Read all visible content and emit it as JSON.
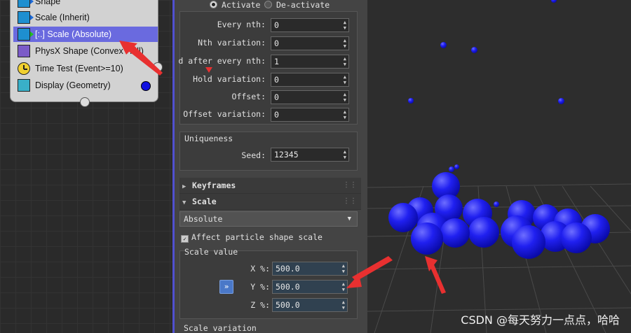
{
  "particle_view": {
    "operators": [
      {
        "label": "Shape",
        "icon": "shape-icon"
      },
      {
        "label": "Scale (Inherit)",
        "icon": "scale-icon"
      },
      {
        "label": "[:.] Scale (Absolute)",
        "icon": "scale-icon",
        "selected": true
      },
      {
        "label": "PhysX Shape (Convex Hull)",
        "icon": "physx-shape-icon"
      },
      {
        "label": "Time Test (Event>=10)",
        "icon": "clock-icon"
      },
      {
        "label": "Display (Geometry)",
        "icon": "display-icon"
      }
    ]
  },
  "params": {
    "activate_label": "Activate",
    "deactivate_label": "De-activate",
    "rows": [
      {
        "label": "Every nth:",
        "value": "0"
      },
      {
        "label": "Nth variation:",
        "value": "0"
      },
      {
        "label": "d after every nth:",
        "value": "1"
      },
      {
        "label": "Hold variation:",
        "value": "0"
      },
      {
        "label": "Offset:",
        "value": "0"
      },
      {
        "label": "Offset variation:",
        "value": "0"
      }
    ],
    "uniqueness_title": "Uniqueness",
    "seed_label": "Seed:",
    "seed_value": "12345",
    "keyframes_title": "Keyframes",
    "scale_title": "Scale",
    "scale_type": "Absolute",
    "affect_label": "Affect particle shape scale",
    "scale_value_title": "Scale value",
    "x_label": "X %:",
    "x_value": "500.0",
    "y_label": "Y %:",
    "y_value": "500.0",
    "z_label": "Z %:",
    "z_value": "500.0",
    "link_label": "»",
    "scale_variation_title": "Scale variation"
  },
  "watermark": "CSDN @每天努力一点点，哈哈",
  "colors": {
    "accent": "#6a6adf",
    "particles": "#1a1af0",
    "annotation": "#e83030"
  }
}
